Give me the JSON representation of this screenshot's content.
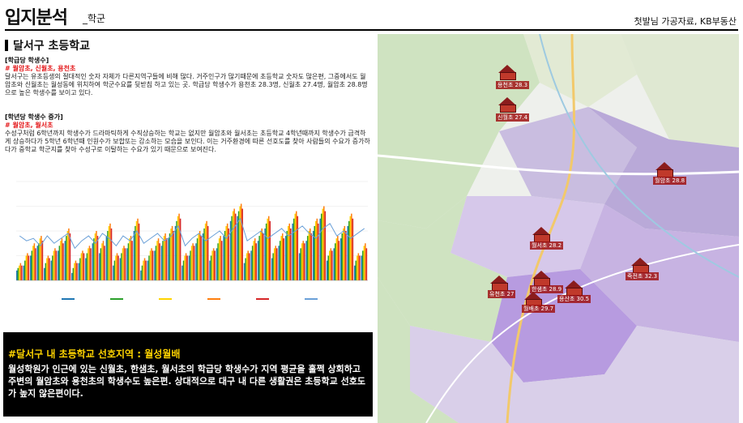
{
  "header": {
    "title": "입지분석",
    "subtitle": "_학군",
    "source": "첫발님 가공자료, KB부동산"
  },
  "section_title": "달서구 초등학교",
  "block1": {
    "heading": "[학급당 학생수]",
    "highlight": "# 월암초, 신월초, 용천초",
    "text": "달서구는 유초등생의 절대적인 숫자 자체가 다른지역구들에 비해 많다. 거주인구가 많기때문에 초등학교 숫자도 많은편, 그중에서도 월암초와 신월초는 월성동에 위치하여 학군수요를 뒷받침 하고 있는 곳. 학급당 학생수가 용천초 28.3명, 신월초 27.4명, 월암초 28.8명으로 높은 학생수를 보이고 있다."
  },
  "block2": {
    "heading": "[학년당 학생수 증가]",
    "highlight": "# 월암초, 월서초",
    "text": "수성구처럼 6학년까지 학생수가 드라마틱하게 수직상승하는 학교는 없지만 월암초와 월서초는 초등학교 4학년때까지 학생수가 급격하게 상승하다가 5학년 6학년때 인원수가 보합또는 감소하는 모습을 보인다. 이는 거주환경에 따른 선호도를 찾아 사람들의 수요가 증가하다가 중학교 학군지를 찾아 수성구로 이탈하는 수요가 있기 때문으로 보여진다."
  },
  "callout": {
    "heading": "#달서구 내 초등학교 선호지역 : 월성월배",
    "text": "월성학원가 인근에 있는 신월초, 한샘초, 월서초의 학급당 학생수가 지역 평균을 훌쩍 상회하고 주변의 월암초와 용천초의 학생수도 높은편. 상대적으로 대구 내 다른 생활권은 초등학교 선호도가 높지 않은편이다."
  },
  "map": {
    "schools": [
      {
        "label": "용천초 28.3"
      },
      {
        "label": "신월초 27.4"
      },
      {
        "label": "월암초 28.8"
      },
      {
        "label": "월서초 28.2"
      },
      {
        "label": "유천초 27"
      },
      {
        "label": "한샘초 28.9"
      },
      {
        "label": "월배초 29.7"
      },
      {
        "label": "용산초 30.5"
      },
      {
        "label": "죽전초 32.3"
      }
    ]
  },
  "chart_data": {
    "type": "bar",
    "categories_count": 51,
    "series": [
      {
        "color": "#1f77b4",
        "values": [
          4,
          6,
          10,
          14,
          5,
          8,
          12,
          16,
          3,
          7,
          9,
          15,
          11,
          18,
          6,
          9,
          13,
          20,
          4,
          8,
          12,
          14,
          17,
          22,
          6,
          10,
          15,
          19,
          8,
          13,
          18,
          24,
          26,
          7,
          12,
          16,
          21,
          9,
          14,
          18,
          23,
          11,
          16,
          20,
          25,
          8,
          13,
          17,
          22,
          6,
          10
        ]
      },
      {
        "color": "#2ca02c",
        "values": [
          5,
          8,
          12,
          15,
          7,
          10,
          14,
          18,
          5,
          9,
          11,
          17,
          13,
          20,
          8,
          11,
          15,
          22,
          6,
          10,
          14,
          16,
          19,
          24,
          8,
          12,
          17,
          21,
          10,
          15,
          20,
          26,
          28,
          9,
          14,
          18,
          23,
          11,
          16,
          20,
          25,
          13,
          18,
          22,
          27,
          10,
          15,
          19,
          24,
          8,
          12
        ]
      },
      {
        "color": "#ffd400",
        "values": [
          6,
          10,
          14,
          17,
          9,
          12,
          16,
          20,
          7,
          11,
          13,
          19,
          15,
          22,
          10,
          13,
          17,
          24,
          8,
          12,
          16,
          18,
          21,
          26,
          10,
          14,
          19,
          23,
          12,
          17,
          22,
          28,
          30,
          11,
          16,
          20,
          25,
          13,
          18,
          22,
          27,
          15,
          20,
          24,
          29,
          12,
          17,
          21,
          26,
          10,
          14
        ]
      },
      {
        "color": "#ff7f0e",
        "values": [
          7,
          11,
          15,
          18,
          10,
          13,
          17,
          21,
          8,
          12,
          14,
          20,
          16,
          23,
          11,
          14,
          18,
          25,
          9,
          13,
          17,
          19,
          22,
          27,
          11,
          15,
          20,
          24,
          13,
          18,
          23,
          29,
          31,
          12,
          17,
          21,
          26,
          14,
          19,
          23,
          28,
          16,
          21,
          25,
          30,
          13,
          18,
          22,
          27,
          11,
          15
        ]
      },
      {
        "color": "#d62728",
        "values": [
          6,
          10,
          13,
          16,
          9,
          12,
          15,
          19,
          7,
          11,
          13,
          18,
          14,
          21,
          10,
          13,
          16,
          23,
          8,
          12,
          15,
          17,
          20,
          25,
          10,
          14,
          18,
          22,
          12,
          16,
          21,
          27,
          29,
          11,
          15,
          19,
          24,
          13,
          17,
          21,
          26,
          15,
          19,
          23,
          28,
          12,
          16,
          20,
          25,
          10,
          13
        ]
      }
    ],
    "line": {
      "color": "#6aa0d8",
      "values": [
        18,
        16,
        17,
        14,
        18,
        15,
        17,
        19,
        13,
        16,
        18,
        15,
        19,
        17,
        14,
        18,
        16,
        20,
        15,
        17,
        19,
        16,
        18,
        22,
        14,
        17,
        19,
        16,
        18,
        20,
        17,
        21,
        25,
        16,
        18,
        20,
        17,
        19,
        21,
        18,
        20,
        22,
        19,
        17,
        21,
        23,
        18,
        20,
        17,
        19,
        21
      ]
    }
  }
}
